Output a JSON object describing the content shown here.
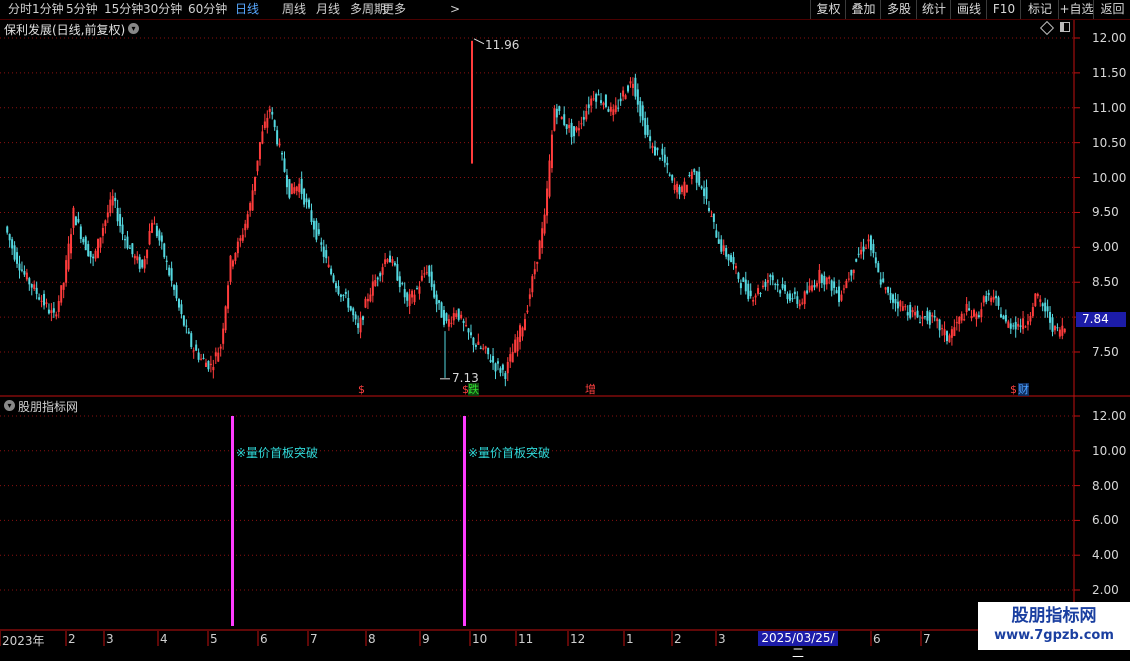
{
  "toolbar": {
    "periods": [
      {
        "label": "分时",
        "active": false
      },
      {
        "label": "1分钟",
        "active": false
      },
      {
        "label": "5分钟",
        "active": false
      },
      {
        "label": "15分钟",
        "active": false
      },
      {
        "label": "30分钟",
        "active": false
      },
      {
        "label": "60分钟",
        "active": false
      },
      {
        "label": "日线",
        "active": true
      },
      {
        "label": "周线",
        "active": false
      },
      {
        "label": "月线",
        "active": false
      },
      {
        "label": "多周期",
        "active": false
      },
      {
        "label": "更多",
        "active": false
      }
    ],
    "more_arrow": ">",
    "right_buttons": [
      "复权",
      "叠加",
      "多股",
      "统计",
      "画线",
      "F10",
      "标记",
      "+自选",
      "返回"
    ]
  },
  "stock": {
    "title": "保利发展(日线,前复权)"
  },
  "indicator": {
    "title": "股朋指标网",
    "signal_label": "※量价首板突破"
  },
  "price_axis": {
    "ticks": [
      "12.00",
      "11.50",
      "11.00",
      "10.50",
      "10.00",
      "9.50",
      "9.00",
      "8.50",
      "8.00",
      "7.50"
    ]
  },
  "current_price": "7.84",
  "annotations": {
    "high": "11.96",
    "low": "7.13"
  },
  "markers": [
    {
      "text": "$",
      "color": "#ff4040"
    },
    {
      "text": "$",
      "color": "#ff4040"
    },
    {
      "text": "跌",
      "color": "#30e030"
    },
    {
      "text": "增",
      "color": "#ff4040"
    },
    {
      "text": "$",
      "color": "#ff4040"
    },
    {
      "text": "财",
      "color": "#4aa0ff"
    }
  ],
  "indicator_axis": {
    "ticks": [
      "12.00",
      "10.00",
      "8.00",
      "6.00",
      "4.00",
      "2.00"
    ]
  },
  "date_axis": {
    "labels": [
      "2023年",
      "2",
      "3",
      "4",
      "5",
      "6",
      "7",
      "8",
      "9",
      "10",
      "11",
      "12",
      "1",
      "2",
      "3",
      "2025/03/25/二",
      "6",
      "7"
    ],
    "selected": "2025/03/25/二"
  },
  "watermark": {
    "line1": "股朋指标网",
    "line2": "www.7gpzb.com"
  },
  "colors": {
    "up": "#ff3c3c",
    "down": "#54d8e0",
    "signal": "#ff3cff",
    "grid": "#8a1010",
    "active_period": "#58a8ff"
  },
  "chart_data": {
    "type": "candlestick",
    "ylim": [
      7.0,
      12.2
    ],
    "high": 11.96,
    "low": 7.13,
    "last": 7.84,
    "close_series": [
      9.3,
      8.9,
      8.6,
      8.4,
      8.2,
      8.0,
      8.5,
      9.5,
      9.1,
      8.8,
      9.3,
      9.7,
      9.2,
      8.9,
      8.7,
      9.4,
      9.0,
      8.5,
      8.0,
      7.6,
      7.4,
      7.3,
      7.6,
      8.8,
      9.1,
      9.6,
      10.5,
      11.0,
      10.4,
      9.8,
      9.9,
      9.5,
      9.1,
      8.7,
      8.4,
      8.2,
      7.8,
      8.3,
      8.6,
      8.9,
      8.6,
      8.2,
      8.4,
      8.7,
      8.2,
      7.9,
      8.1,
      7.8,
      7.6,
      7.5,
      7.3,
      7.2,
      7.6,
      8.0,
      8.7,
      9.4,
      11.0,
      10.8,
      10.6,
      10.9,
      11.2,
      11.1,
      10.9,
      11.2,
      11.4,
      10.8,
      10.4,
      10.3,
      9.9,
      9.8,
      10.1,
      9.9,
      9.4,
      9.0,
      8.8,
      8.5,
      8.3,
      8.4,
      8.6,
      8.4,
      8.3,
      8.2,
      8.4,
      8.6,
      8.5,
      8.3,
      8.6,
      8.9,
      9.1,
      8.6,
      8.3,
      8.2,
      8.1,
      8.0,
      8.0,
      7.9,
      7.7,
      7.9,
      8.1,
      8.0,
      8.3,
      8.2,
      7.9,
      7.9,
      7.9,
      8.3,
      8.1,
      7.8,
      7.84
    ]
  }
}
